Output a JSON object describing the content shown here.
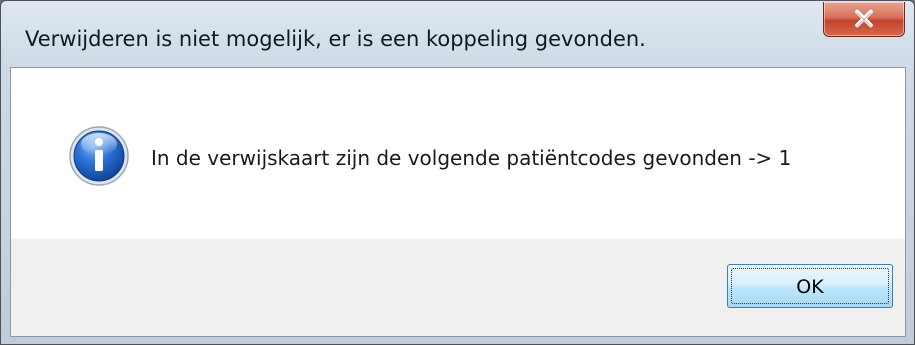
{
  "dialog": {
    "title": "Verwijderen is niet mogelijk, er is een koppeling gevonden.",
    "message": "In de verwijskaart zijn de volgende patiëntcodes gevonden -> 1",
    "icon": "info-icon",
    "ok_label": "OK",
    "close_icon": "close-icon"
  },
  "colors": {
    "close_button": "#c4442b",
    "ok_button_border": "#3c7fb1",
    "info_icon": "#1c5fbf",
    "message_area": "#ffffff",
    "button_area": "#f0f0f0"
  }
}
